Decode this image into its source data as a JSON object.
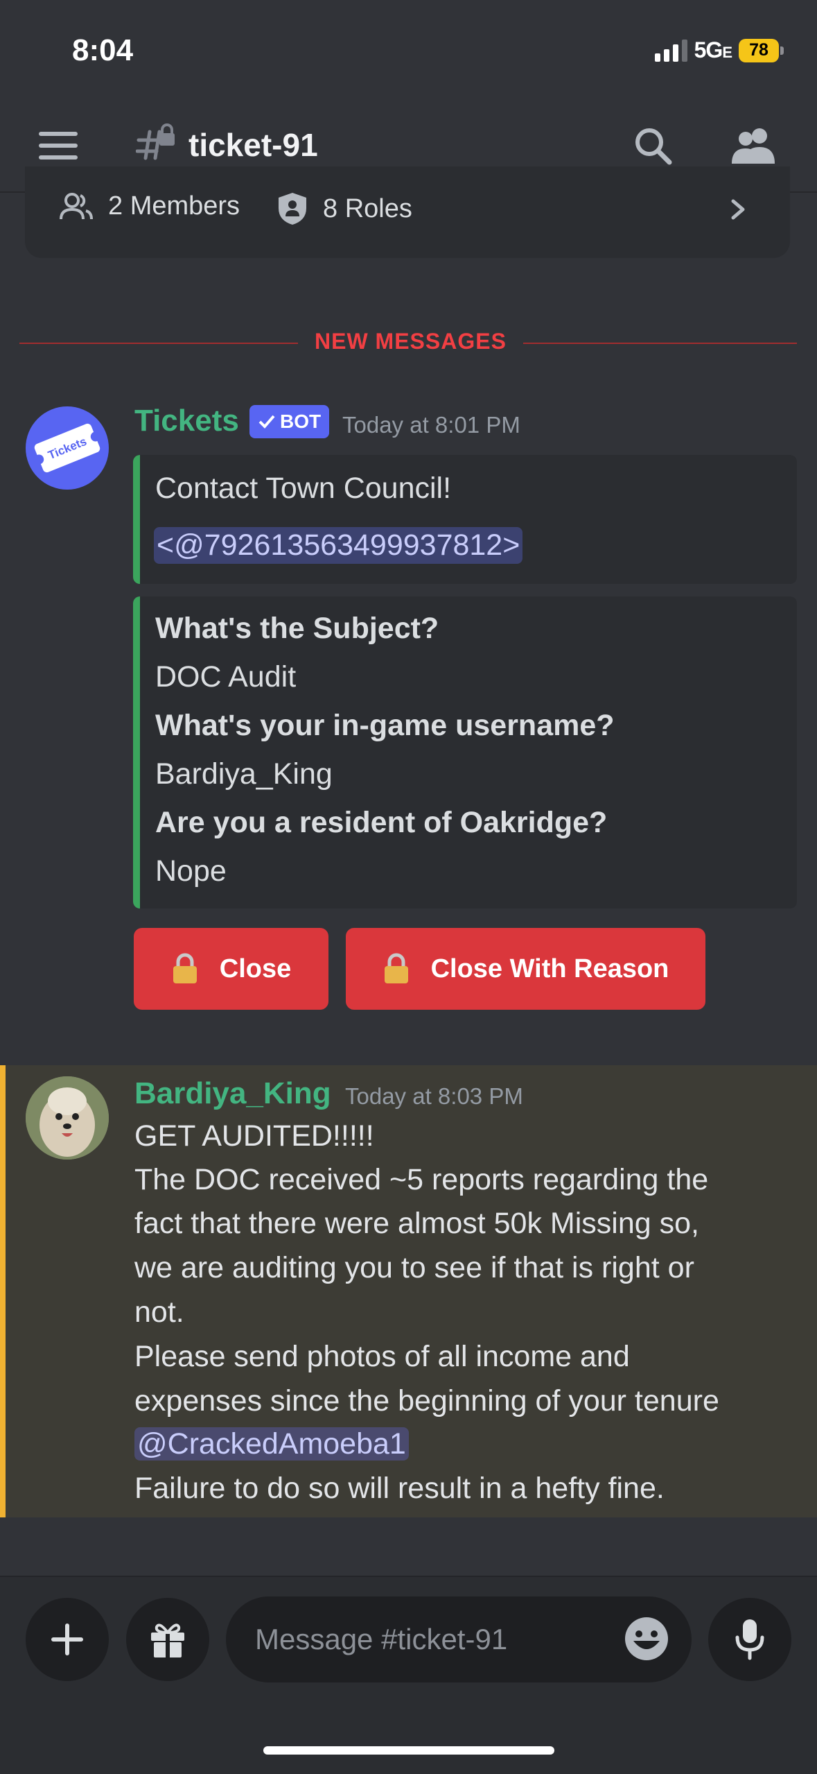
{
  "status_bar": {
    "time": "8:04",
    "network": "5G",
    "network_suffix": "E",
    "battery": "78"
  },
  "header": {
    "channel_name": "ticket-91"
  },
  "channel_info": {
    "members": "2 Members",
    "roles": "8 Roles"
  },
  "divider": {
    "label": "NEW MESSAGES"
  },
  "bot_message": {
    "author": "Tickets",
    "badge": "BOT",
    "timestamp": "Today at 8:01 PM",
    "avatar_text": "Tickets",
    "embed1": {
      "title": "Contact Town Council!",
      "mention": "<@792613563499937812>"
    },
    "embed2": {
      "fields": [
        {
          "name": "What's the Subject?",
          "value": "DOC Audit"
        },
        {
          "name": "What's your in-game username?",
          "value": "Bardiya_King"
        },
        {
          "name": "Are you a resident of Oakridge?",
          "value": "Nope"
        }
      ]
    },
    "buttons": {
      "close": "Close",
      "close_with_reason": "Close With Reason"
    }
  },
  "user_message": {
    "author": "Bardiya_King",
    "timestamp": "Today at 8:03 PM",
    "lines": [
      "GET AUDITED!!!!!",
      "The DOC received ~5 reports regarding the",
      "fact that there were almost 50k Missing so,",
      "we are auditing you to see if that is right or",
      "not.",
      "Please send photos of all income and",
      "expenses since the beginning of your tenure"
    ],
    "mention": "@CrackedAmoeba1",
    "last_line": "Failure to do so will result in a hefty fine."
  },
  "composer": {
    "placeholder": "Message #ticket-91"
  },
  "colors": {
    "background": "#313338",
    "username_green": "#43b581",
    "embed_border": "#3ba55d",
    "danger_button": "#da373c",
    "bot_badge": "#5865f2",
    "new_messages": "#f23f43",
    "mention_highlight_bar": "#f0b232"
  },
  "icons": [
    "menu-icon",
    "channel-lock-icon",
    "search-icon",
    "members-icon",
    "member-icon",
    "role-shield-icon",
    "chevron-right-icon",
    "lock-icon",
    "plus-icon",
    "gift-icon",
    "emoji-icon",
    "mic-icon"
  ]
}
